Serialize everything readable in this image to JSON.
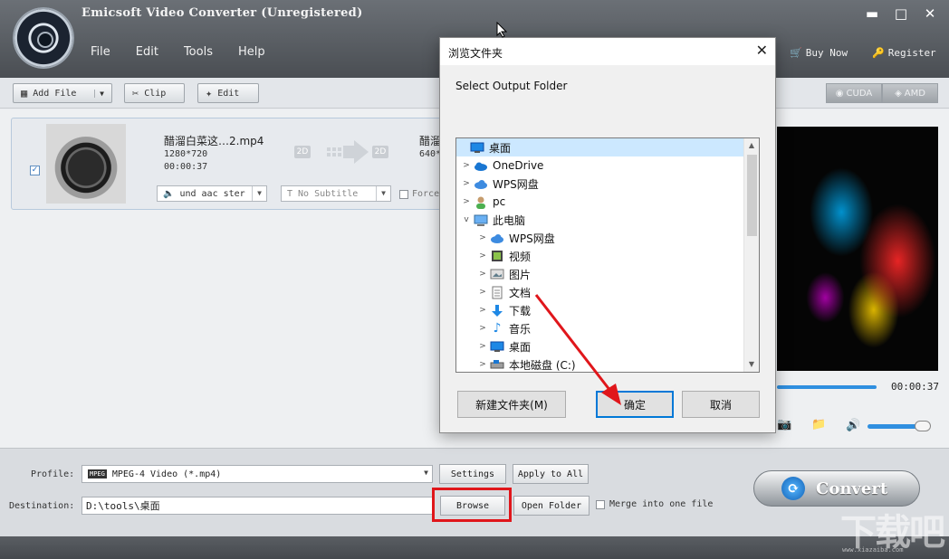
{
  "app": {
    "title": "Emicsoft Video Converter (Unregistered)",
    "menu": [
      "File",
      "Edit",
      "Tools",
      "Help"
    ],
    "buy_now": "Buy Now",
    "register": "Register",
    "window_controls": {
      "minimize": "▬",
      "maximize": "□",
      "close": "✕"
    }
  },
  "toolbar": {
    "add_file": "Add File",
    "clip": "Clip",
    "edit": "Edit",
    "cuda": "CUDA",
    "amd": "AMD"
  },
  "file_item": {
    "checked": true,
    "source_name": "醋溜白菜这…2.mp4",
    "source_resolution": "1280*720",
    "source_duration": "00:00:37",
    "badge_2d": "2D",
    "dest_name": "醋溜",
    "dest_resolution": "640*",
    "audio_track": "und aac ster",
    "subtitle": "No Subtitle",
    "forced": "Force"
  },
  "preview": {
    "time": "00:00:37"
  },
  "bottom": {
    "profile_label": "Profile:",
    "profile_value": "MPEG-4 Video (*.mp4)",
    "profile_icon_text": "MPEG",
    "settings": "Settings",
    "apply_to_all": "Apply to All",
    "destination_label": "Destination:",
    "destination_value": "D:\\tools\\桌面",
    "browse": "Browse",
    "open_folder": "Open Folder",
    "merge": "Merge into one file",
    "convert": "Convert"
  },
  "dialog": {
    "title": "浏览文件夹",
    "prompt": "Select Output Folder",
    "tree": [
      {
        "label": "桌面",
        "level": 0,
        "expander": "",
        "icon": "desktop-icon",
        "selected": true
      },
      {
        "label": "OneDrive",
        "level": 0,
        "expander": ">",
        "icon": "cloud-icon"
      },
      {
        "label": "WPS网盘",
        "level": 0,
        "expander": ">",
        "icon": "wps-cloud-icon"
      },
      {
        "label": "pc",
        "level": 0,
        "expander": ">",
        "icon": "user-icon"
      },
      {
        "label": "此电脑",
        "level": 0,
        "expander": "v",
        "icon": "computer-icon"
      },
      {
        "label": "WPS网盘",
        "level": 1,
        "expander": ">",
        "icon": "wps-cloud-icon"
      },
      {
        "label": "视频",
        "level": 1,
        "expander": ">",
        "icon": "video-folder-icon"
      },
      {
        "label": "图片",
        "level": 1,
        "expander": ">",
        "icon": "pictures-folder-icon"
      },
      {
        "label": "文档",
        "level": 1,
        "expander": ">",
        "icon": "documents-folder-icon"
      },
      {
        "label": "下载",
        "level": 1,
        "expander": ">",
        "icon": "download-folder-icon"
      },
      {
        "label": "音乐",
        "level": 1,
        "expander": ">",
        "icon": "music-folder-icon"
      },
      {
        "label": "桌面",
        "level": 1,
        "expander": ">",
        "icon": "desktop-icon"
      },
      {
        "label": "本地磁盘 (C:)",
        "level": 1,
        "expander": ">",
        "icon": "drive-icon"
      }
    ],
    "new_folder": "新建文件夹(M)",
    "ok": "确定",
    "cancel": "取消"
  },
  "watermark": {
    "text": "下载吧",
    "sub": "www.xiazaiba.com"
  },
  "colors": {
    "highlight_red": "#e0161b",
    "accent_blue": "#2f8fe0",
    "tree_selected": "#cce8ff"
  }
}
